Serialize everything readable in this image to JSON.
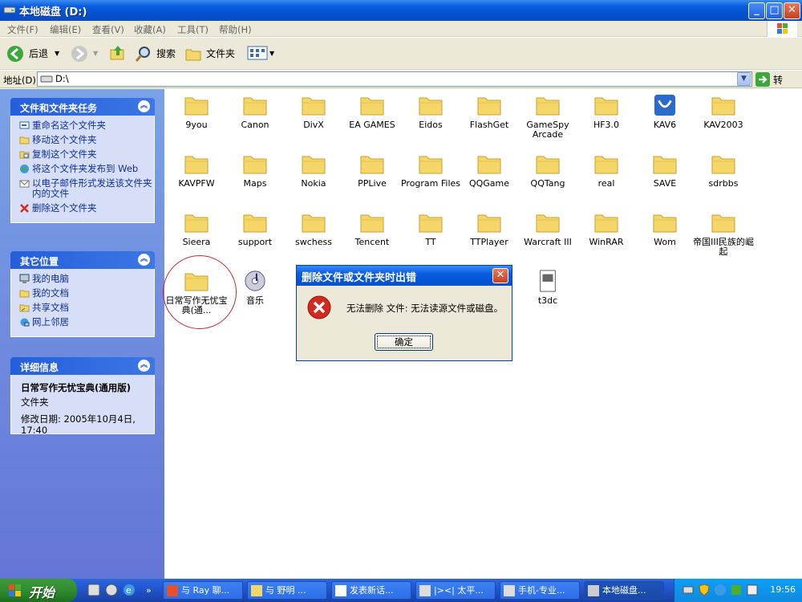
{
  "window": {
    "title": "本地磁盘 (D:)",
    "min": "_",
    "max": "□",
    "close": "✕"
  },
  "menu": [
    "文件(F)",
    "编辑(E)",
    "查看(V)",
    "收藏(A)",
    "工具(T)",
    "帮助(H)"
  ],
  "toolbar": {
    "back": "后退",
    "search": "搜索",
    "folders": "文件夹"
  },
  "address": {
    "label": "地址(D)",
    "value": "D:\\",
    "go": "转到"
  },
  "tasks_panel": {
    "title": "文件和文件夹任务",
    "items": [
      "重命名这个文件夹",
      "移动这个文件夹",
      "复制这个文件夹",
      "将这个文件夹发布到 Web",
      "以电子邮件形式发送该文件夹内的文件",
      "删除这个文件夹"
    ]
  },
  "places_panel": {
    "title": "其它位置",
    "items": [
      "我的电脑",
      "我的文档",
      "共享文档",
      "网上邻居"
    ]
  },
  "details_panel": {
    "title": "详细信息",
    "name": "日常写作无忧宝典(通用版)",
    "type": "文件夹",
    "modified": "修改日期: 2005年10月4日, 17:40"
  },
  "items": [
    "9you",
    "Canon",
    "DivX",
    "EA GAMES",
    "Eidos",
    "FlashGet",
    "GameSpy Arcade",
    "HF3.0",
    "KAV6",
    "KAV2003",
    "KAVPFW",
    "Maps",
    "Nokia",
    "PPLive",
    "Program Files",
    "QQGame",
    "QQTang",
    "real",
    "SAVE",
    "sdrbbs",
    "Sieera",
    "support",
    "swchess",
    "Tencent",
    "TT",
    "TTPlayer",
    "Warcraft III",
    "WinRAR",
    "Wom",
    "帝国III民族的崛起",
    "日常写作无忧宝典(通...",
    "音乐",
    "t3dc"
  ],
  "dialog": {
    "title": "删除文件或文件夹时出错",
    "message": "无法删除 文件: 无法读源文件或磁盘。",
    "ok": "确定"
  },
  "taskbar": {
    "start": "开始",
    "buttons": [
      "与 Ray 聊...",
      "与 野明 ...",
      "发表新话...",
      "|><| 太平...",
      "手机-专业...",
      "本地磁盘..."
    ],
    "clock": "19:56"
  },
  "colors": {
    "accent": "#0a5ce0",
    "panel_bg": "#d6dff7",
    "folder": "#f5d769",
    "error": "#d42a1e"
  }
}
